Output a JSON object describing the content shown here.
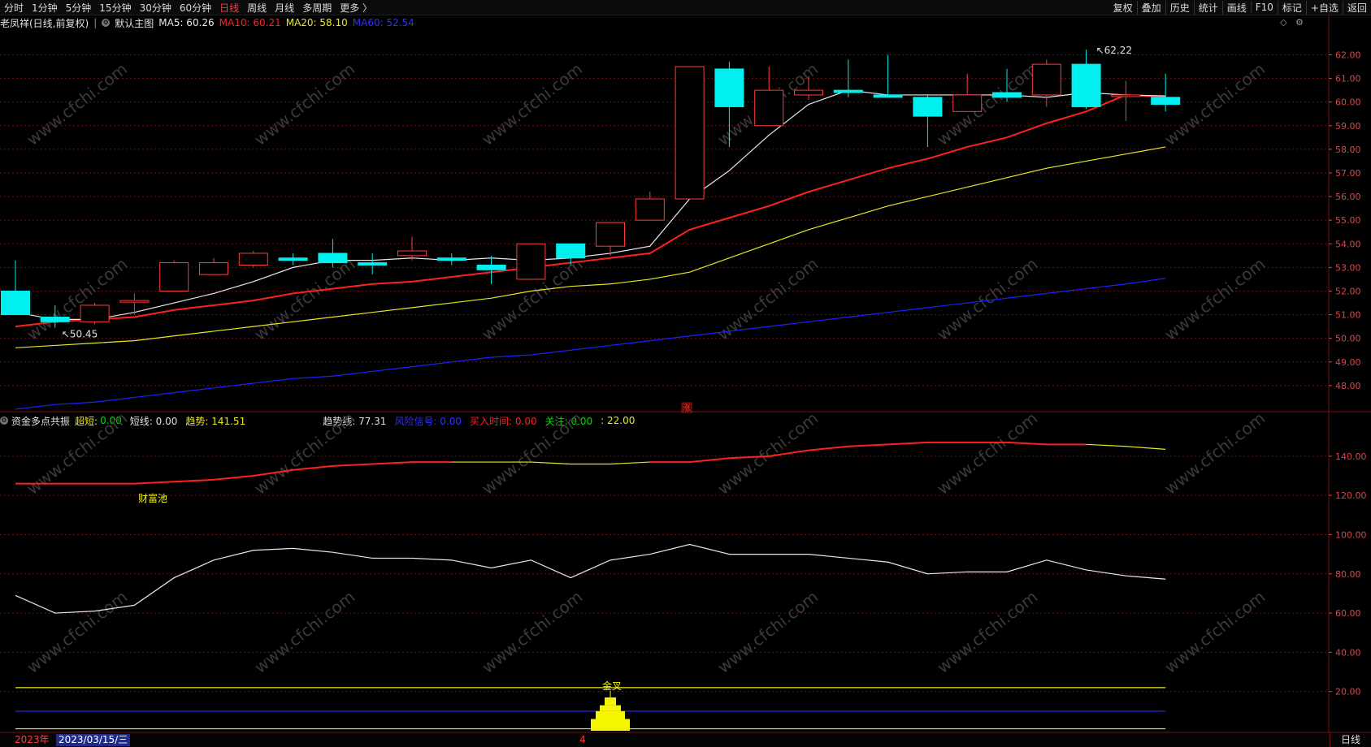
{
  "toolbar": {
    "periods": [
      "分时",
      "1分钟",
      "5分钟",
      "15分钟",
      "30分钟",
      "60分钟",
      "日线",
      "周线",
      "月线",
      "多周期",
      "更多 〉"
    ],
    "active_period": "日线",
    "tools": [
      "复权",
      "叠加",
      "历史",
      "统计",
      "画线",
      "F10",
      "标记",
      "+自选",
      "返回"
    ]
  },
  "main_header": {
    "stock": "老凤祥(日线,前复权)",
    "template": "默认主图",
    "ma5": "MA5: 60.26",
    "ma10": "MA10: 60.21",
    "ma20": "MA20: 58.10",
    "ma60": "MA60: 52.54"
  },
  "sub_header": {
    "name": "资金多点共振",
    "chaoduan_label": "超短:",
    "chaoduan_val": "0.00",
    "duanxian": "短线: 0.00",
    "qushi": "趋势: 141.51",
    "qushixian": "趋势线: 77.31",
    "fengxian": "风险信号: 0.00",
    "mairu": "买入时间: 0.00",
    "guanzhu": "关注: 0.00",
    "extra": ": 22.00"
  },
  "labels": {
    "high": "62.22",
    "low": "50.45",
    "zhang": "涨",
    "caifuchi": "财富池",
    "jincha": "金叉",
    "watermark": "www.cfchi.com"
  },
  "date_bar": {
    "year": "2023年",
    "selected": "2023/03/15/三",
    "month_tick": "4",
    "period_badge": "日线"
  },
  "colors": {
    "up": "#ff3b3b",
    "down": "#00f0f0",
    "ma5": "#e8e8e8",
    "ma10": "#ff2020",
    "ma20": "#e8e820",
    "ma60": "#2020ff",
    "grid": "#7a0f0f"
  },
  "chart_data": {
    "type": "candlestick",
    "price_axis": {
      "ticks": [
        48.0,
        49.0,
        50.0,
        51.0,
        52.0,
        53.0,
        54.0,
        55.0,
        56.0,
        57.0,
        58.0,
        59.0,
        60.0,
        61.0,
        62.0
      ],
      "labels": [
        "48.00",
        "49.00",
        "50.00",
        "51.00",
        "52.00",
        "53.00",
        "54.00",
        "55.00",
        "56.00",
        "57.00",
        "58.00",
        "59.00",
        "60.00",
        "61.00",
        "62.00"
      ],
      "range": [
        47.0,
        62.6
      ]
    },
    "candles": [
      {
        "o": 52.0,
        "h": 53.3,
        "l": 51.0,
        "c": 51.0
      },
      {
        "o": 50.9,
        "h": 51.4,
        "l": 50.45,
        "c": 50.7
      },
      {
        "o": 50.7,
        "h": 51.5,
        "l": 50.6,
        "c": 51.4
      },
      {
        "o": 51.6,
        "h": 51.9,
        "l": 51.0,
        "c": 51.6
      },
      {
        "o": 52.0,
        "h": 53.3,
        "l": 52.0,
        "c": 53.2
      },
      {
        "o": 52.7,
        "h": 53.4,
        "l": 52.7,
        "c": 53.2
      },
      {
        "o": 53.1,
        "h": 53.7,
        "l": 53.0,
        "c": 53.6
      },
      {
        "o": 53.4,
        "h": 53.6,
        "l": 53.1,
        "c": 53.3
      },
      {
        "o": 53.6,
        "h": 54.2,
        "l": 53.0,
        "c": 53.2
      },
      {
        "o": 53.2,
        "h": 53.6,
        "l": 52.7,
        "c": 53.1
      },
      {
        "o": 53.5,
        "h": 54.3,
        "l": 53.3,
        "c": 53.7
      },
      {
        "o": 53.4,
        "h": 53.6,
        "l": 53.1,
        "c": 53.3
      },
      {
        "o": 53.1,
        "h": 53.5,
        "l": 52.3,
        "c": 52.9
      },
      {
        "o": 52.5,
        "h": 54.0,
        "l": 52.5,
        "c": 54.0
      },
      {
        "o": 54.0,
        "h": 54.0,
        "l": 53.1,
        "c": 53.4
      },
      {
        "o": 53.9,
        "h": 54.9,
        "l": 53.5,
        "c": 54.9
      },
      {
        "o": 55.0,
        "h": 56.2,
        "l": 55.0,
        "c": 55.9
      },
      {
        "o": 55.9,
        "h": 61.5,
        "l": 55.9,
        "c": 61.5
      },
      {
        "o": 61.4,
        "h": 61.7,
        "l": 58.1,
        "c": 59.8
      },
      {
        "o": 59.0,
        "h": 61.5,
        "l": 59.0,
        "c": 60.5
      },
      {
        "o": 60.3,
        "h": 61.1,
        "l": 60.1,
        "c": 60.5
      },
      {
        "o": 60.5,
        "h": 61.8,
        "l": 60.2,
        "c": 60.4
      },
      {
        "o": 60.3,
        "h": 62.0,
        "l": 60.2,
        "c": 60.2
      },
      {
        "o": 60.2,
        "h": 60.3,
        "l": 58.1,
        "c": 59.4
      },
      {
        "o": 59.6,
        "h": 61.2,
        "l": 59.6,
        "c": 60.3
      },
      {
        "o": 60.4,
        "h": 61.4,
        "l": 60.0,
        "c": 60.2
      },
      {
        "o": 60.3,
        "h": 61.8,
        "l": 59.8,
        "c": 61.6
      },
      {
        "o": 61.6,
        "h": 62.22,
        "l": 59.7,
        "c": 59.8
      },
      {
        "o": 60.3,
        "h": 60.9,
        "l": 59.2,
        "c": 60.3
      },
      {
        "o": 60.2,
        "h": 61.2,
        "l": 59.6,
        "c": 59.9
      }
    ],
    "ma5": [
      51.1,
      50.8,
      50.8,
      51.1,
      51.5,
      51.9,
      52.4,
      53.0,
      53.3,
      53.3,
      53.4,
      53.3,
      53.4,
      53.3,
      53.4,
      53.6,
      53.9,
      55.9,
      57.1,
      58.6,
      59.9,
      60.5,
      60.3,
      60.3,
      60.3,
      60.3,
      60.2,
      60.4,
      60.3,
      60.26
    ],
    "ma10": [
      50.5,
      50.7,
      50.8,
      50.9,
      51.2,
      51.4,
      51.6,
      51.9,
      52.1,
      52.3,
      52.4,
      52.6,
      52.8,
      53.0,
      53.2,
      53.4,
      53.6,
      54.6,
      55.1,
      55.6,
      56.2,
      56.7,
      57.2,
      57.6,
      58.1,
      58.5,
      59.1,
      59.6,
      60.3,
      60.21
    ],
    "ma20": [
      49.6,
      49.7,
      49.8,
      49.9,
      50.1,
      50.3,
      50.5,
      50.7,
      50.9,
      51.1,
      51.3,
      51.5,
      51.7,
      52.0,
      52.2,
      52.3,
      52.5,
      52.8,
      53.4,
      54.0,
      54.6,
      55.1,
      55.6,
      56.0,
      56.4,
      56.8,
      57.2,
      57.5,
      57.8,
      58.1
    ],
    "ma60": [
      47.0,
      47.2,
      47.3,
      47.5,
      47.7,
      47.9,
      48.1,
      48.3,
      48.4,
      48.6,
      48.8,
      49.0,
      49.2,
      49.3,
      49.5,
      49.7,
      49.9,
      50.1,
      50.3,
      50.5,
      50.7,
      50.9,
      51.1,
      51.3,
      51.5,
      51.7,
      51.9,
      52.1,
      52.3,
      52.54
    ],
    "indicator_axis": {
      "ticks": [
        20,
        40,
        60,
        80,
        100,
        120,
        140
      ],
      "labels": [
        "20.00",
        "40.00",
        "60.00",
        "80.00",
        "100.00",
        "120.00",
        "140.00"
      ],
      "range": [
        0,
        154
      ]
    },
    "trend": [
      126,
      126,
      126,
      126,
      127,
      128,
      130,
      133,
      135,
      136,
      137,
      137,
      137,
      137,
      136,
      136,
      137,
      137,
      139,
      140,
      143,
      145,
      146,
      147,
      147,
      147,
      146,
      146,
      145,
      143.5
    ],
    "trend_yellow_from": 11,
    "trend_yellow_to": 16,
    "trend_yellow_from2": 27,
    "trendline": [
      69,
      60,
      61,
      64,
      78,
      87,
      92,
      93,
      91,
      88,
      88,
      87,
      83,
      87,
      78,
      87,
      90,
      95,
      90,
      90,
      90,
      88,
      86,
      80,
      81,
      81,
      87,
      82,
      79,
      77.31
    ],
    "hline_yellow_upper": 22,
    "hline_blue": 10,
    "hline_yellow_lower": 1,
    "signal_bar_index": 15,
    "signal_bar_levels": [
      6,
      10,
      13,
      17
    ]
  }
}
